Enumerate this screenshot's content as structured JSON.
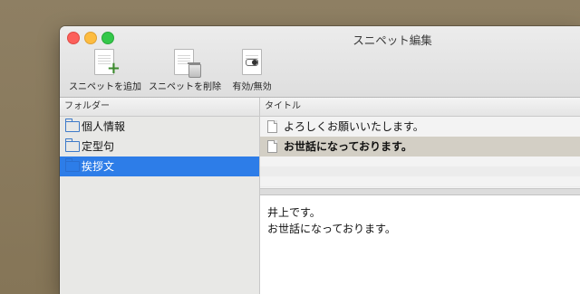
{
  "window": {
    "title": "スニペット編集"
  },
  "toolbar": {
    "add_label": "スニペットを追加",
    "delete_label": "スニペットを削除",
    "toggle_label": "有効/無効"
  },
  "sidebar": {
    "header": "フォルダー",
    "items": [
      {
        "label": "個人情報"
      },
      {
        "label": "定型句"
      },
      {
        "label": "挨拶文"
      }
    ],
    "selected_index": 2
  },
  "snippets": {
    "header": "タイトル",
    "items": [
      {
        "label": "よろしくお願いいたします。"
      },
      {
        "label": "お世話になっております。"
      }
    ],
    "selected_index": 1
  },
  "editor": {
    "content": "井上です。\nお世話になっております。"
  },
  "colors": {
    "selection_blue": "#2d7de8",
    "selected_row": "#d3cfc5",
    "close": "#fc605b",
    "minimize": "#fdbc40",
    "maximize": "#34c84a",
    "add_icon_green": "#3c8a2e"
  }
}
